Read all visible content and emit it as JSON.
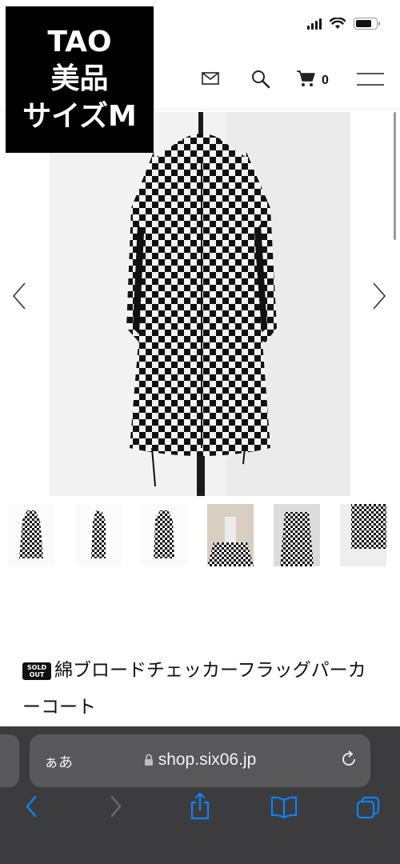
{
  "overlay": {
    "line1": "TAO",
    "line2": "美品",
    "line3": "サイズM"
  },
  "status_bar": {
    "icons": [
      "cellular-signal-icon",
      "wifi-icon",
      "battery-icon"
    ],
    "battery_level": 0.8
  },
  "header": {
    "icons": [
      "mail-icon",
      "search-icon",
      "cart-icon",
      "menu-icon"
    ],
    "cart_count": "0"
  },
  "gallery": {
    "image": "black-and-white checkered parka coat on mannequin",
    "thumbnail_count": 6,
    "nav": [
      "previous-arrow-icon",
      "next-arrow-icon"
    ]
  },
  "product": {
    "status_badge": "SOLD OUT",
    "title": "綿ブロードチェッカーフラッグパーカーコート"
  },
  "browser": {
    "text_size_button": "ぁあ",
    "url": "shop.six06.jp",
    "toolbar": [
      "back-icon",
      "forward-icon",
      "share-icon",
      "bookmarks-icon",
      "tabs-icon"
    ]
  },
  "colors": {
    "chrome_bg": "#3c3c3e",
    "url_field_bg": "#58585b",
    "accent_blue": "#0a84ff"
  }
}
